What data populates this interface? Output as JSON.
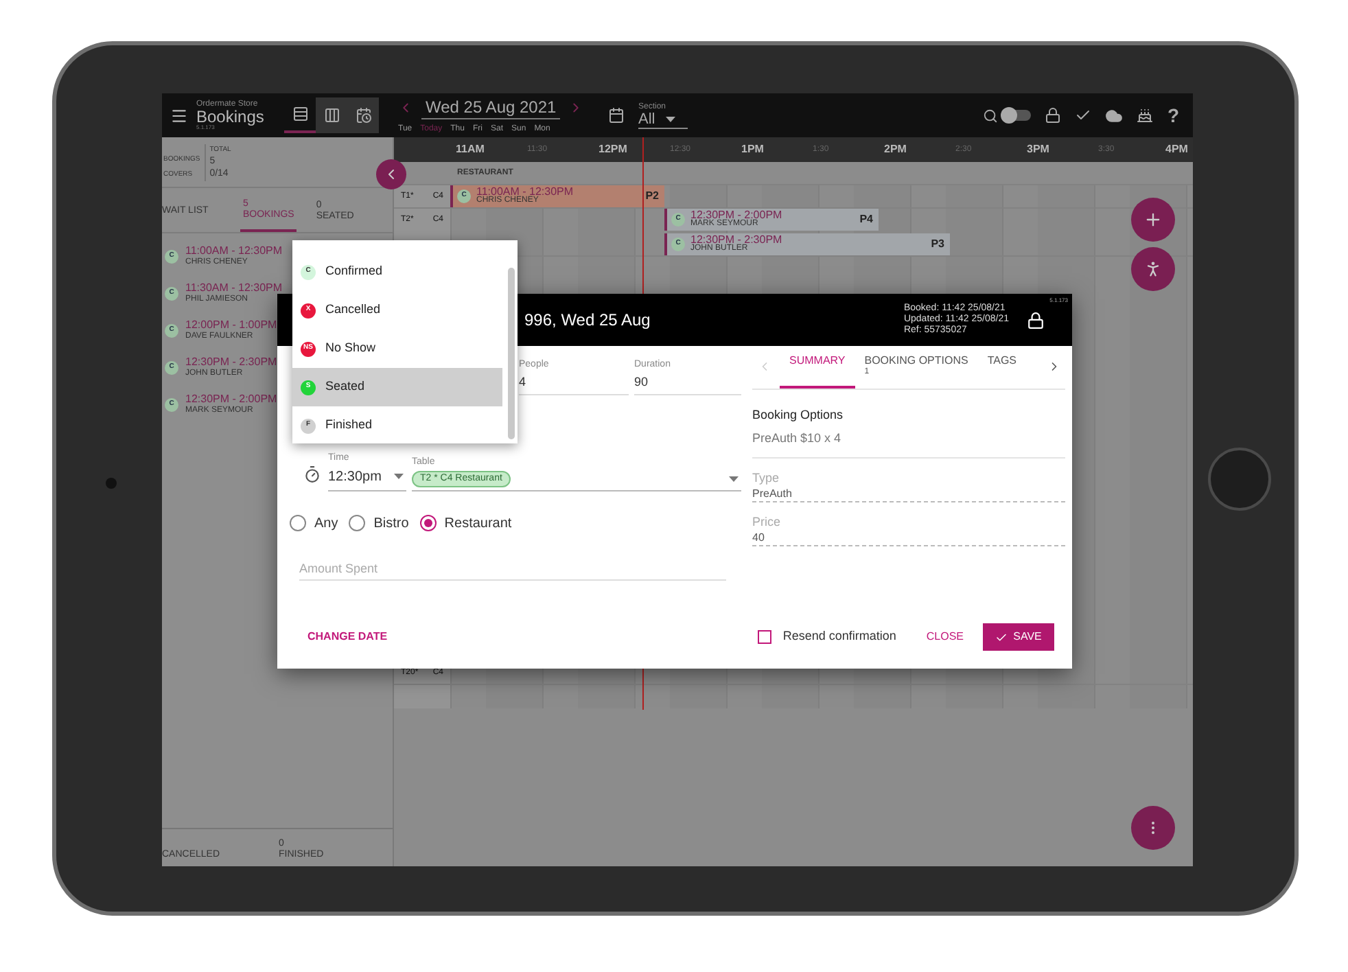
{
  "top_bar": {
    "store": "Ordermate Store",
    "title": "Bookings",
    "version": "5.1.173",
    "views": [
      {
        "kind": "rows",
        "selected": true
      },
      {
        "kind": "columns",
        "selected": false
      },
      {
        "kind": "schedule",
        "selected": false
      }
    ],
    "date": "Wed 25 Aug 2021",
    "days": [
      {
        "label": "Tue",
        "selected": false
      },
      {
        "label": "Today",
        "selected": true
      },
      {
        "label": "Thu",
        "selected": false
      },
      {
        "label": "Fri",
        "selected": false
      },
      {
        "label": "Sat",
        "selected": false
      },
      {
        "label": "Sun",
        "selected": false
      },
      {
        "label": "Mon",
        "selected": false
      }
    ],
    "section": {
      "label": "Section",
      "value": "All"
    },
    "toggle_on": false,
    "help": "?"
  },
  "summary": {
    "header": "TOTAL",
    "rows": [
      {
        "label": "BOOKINGS",
        "value": "5"
      },
      {
        "label": "COVERS",
        "value": "0/14"
      }
    ]
  },
  "list_tabs": [
    {
      "label": "WAIT LIST",
      "selected": false
    },
    {
      "count": "5",
      "label": "BOOKINGS",
      "selected": true
    },
    {
      "count": "0",
      "label": "SEATED",
      "selected": false
    }
  ],
  "bookings": [
    {
      "status": "C",
      "time": "11:00AM - 12:30PM",
      "name": "CHRIS CHENEY"
    },
    {
      "status": "C",
      "time": "11:30AM - 12:30PM",
      "name": "PHIL JAMIESON"
    },
    {
      "status": "C",
      "time": "12:00PM - 1:00PM",
      "name": "DAVE FAULKNER"
    },
    {
      "status": "C",
      "time": "12:30PM - 2:30PM",
      "name": "JOHN BUTLER"
    },
    {
      "status": "C",
      "time": "12:30PM - 2:00PM",
      "name": "MARK SEYMOUR"
    }
  ],
  "footer_counts": [
    {
      "label": "CANCELLED"
    },
    {
      "count": "0",
      "label": "FINISHED"
    }
  ],
  "timeline": {
    "times": [
      {
        "label": "11AM",
        "major": true
      },
      {
        "label": "11:30",
        "major": false
      },
      {
        "label": "12PM",
        "major": true
      },
      {
        "label": "12:30",
        "major": false
      },
      {
        "label": "1PM",
        "major": true
      },
      {
        "label": "1:30",
        "major": false
      },
      {
        "label": "2PM",
        "major": true
      },
      {
        "label": "2:30",
        "major": false
      },
      {
        "label": "3PM",
        "major": true
      },
      {
        "label": "3:30",
        "major": false
      },
      {
        "label": "4PM",
        "major": true
      }
    ],
    "section": "RESTAURANT",
    "rows": [
      {
        "table": "T1*",
        "covers": "C4",
        "bookings": [
          {
            "status": "C",
            "time": "11:00AM - 12:30PM",
            "name": "CHRIS CHENEY",
            "party": "P2",
            "color": "#b3806f"
          }
        ]
      },
      {
        "table": "T2*",
        "covers": "C4",
        "bookings": [
          {
            "status": "C",
            "time": "12:30PM - 2:00PM",
            "name": "MARK SEYMOUR",
            "party": "P4",
            "color": "#a2a6aa"
          },
          {
            "status": "C",
            "time": "12:30PM - 2:30PM",
            "name": "JOHN BUTLER",
            "party": "P3",
            "color": "#a2a6aa"
          }
        ]
      },
      {
        "table": "T20*",
        "covers": "C4"
      }
    ]
  },
  "status_menu": [
    {
      "badge": "C",
      "label": "Confirmed",
      "color": "#d3f5dc",
      "selected": false
    },
    {
      "badge": "X",
      "label": "Cancelled",
      "color": "#e8173d",
      "selected": false
    },
    {
      "badge": "NS",
      "label": "No Show",
      "color": "#e8173d",
      "selected": false
    },
    {
      "badge": "S",
      "label": "Seated",
      "color": "#22d43a",
      "selected": true
    },
    {
      "badge": "F",
      "label": "Finished",
      "color": "#d0d0d0",
      "selected": false
    }
  ],
  "modal": {
    "title": "996, Wed 25 Aug",
    "booked": "Booked: 11:42 25/08/21",
    "updated": "Updated: 11:42 25/08/21",
    "ref": "Ref: 55735027",
    "version": "5.1.173",
    "fields": [
      {
        "label": "People",
        "value": "4"
      },
      {
        "label": "Duration",
        "value": "90"
      }
    ],
    "time": {
      "label": "Time",
      "value": "12:30pm"
    },
    "table": {
      "label": "Table",
      "chip": "T2 * C4 Restaurant"
    },
    "areas": [
      {
        "label": "Any",
        "selected": false
      },
      {
        "label": "Bistro",
        "selected": false
      },
      {
        "label": "Restaurant",
        "selected": true
      }
    ],
    "amount": {
      "placeholder": "Amount Spent"
    },
    "tabs": [
      {
        "label": "SUMMARY",
        "selected": true
      },
      {
        "label": "BOOKING OPTIONS",
        "count": "1",
        "selected": false
      },
      {
        "label": "TAGS",
        "selected": false
      }
    ],
    "summary": {
      "heading": "Booking Options",
      "text": "PreAuth $10 x 4",
      "details": [
        {
          "label": "Type",
          "value": "PreAuth"
        },
        {
          "label": "Price",
          "value": "40"
        }
      ]
    },
    "change_date": "CHANGE DATE",
    "resend": {
      "label": "Resend confirmation",
      "checked": false
    },
    "close": "CLOSE",
    "save": "SAVE"
  }
}
